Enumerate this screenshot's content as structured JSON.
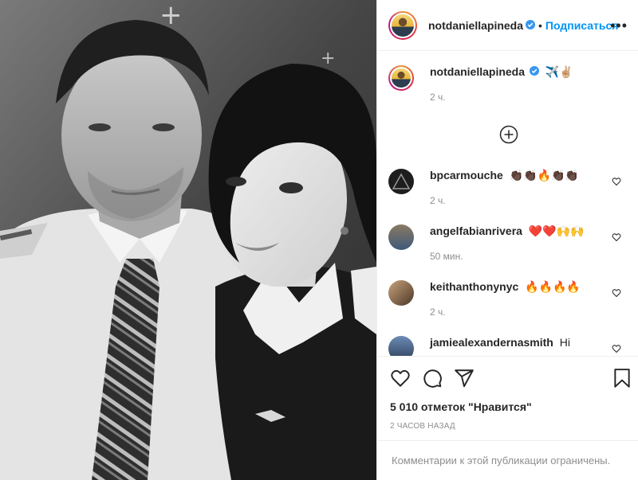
{
  "post": {
    "username": "notdaniellapineda",
    "follow_label": "Подписаться",
    "more_label": "•••",
    "separator": "•"
  },
  "caption": {
    "username": "notdaniellapineda",
    "emoji": "✈️✌🏼",
    "time": "2 ч."
  },
  "comments": [
    {
      "username": "bpcarmouche",
      "text": "👏🏿👏🏿🔥👏🏿👏🏿",
      "time": "2 ч."
    },
    {
      "username": "angelfabianrivera",
      "text": "❤️❤️🙌🙌",
      "time": "50 мин."
    },
    {
      "username": "keithanthonynyc",
      "text": "🔥🔥🔥🔥",
      "time": "2 ч."
    },
    {
      "username": "jamiealexandernasmith",
      "text": "Hi",
      "time": ""
    }
  ],
  "likes_text": "5 010 отметок \"Нравится\"",
  "timestamp": "2 ЧАСОВ НАЗАД",
  "comments_limited": "Комментарии к этой публикации ограничены.",
  "colors": {
    "accent": "#0095f6",
    "verified": "#3897f0",
    "muted": "#8e8e8e",
    "border": "#efefef"
  },
  "icons": [
    "verified-badge-icon",
    "more-icon",
    "plus-circle-icon",
    "heart-icon",
    "comment-icon",
    "share-icon",
    "bookmark-icon"
  ]
}
